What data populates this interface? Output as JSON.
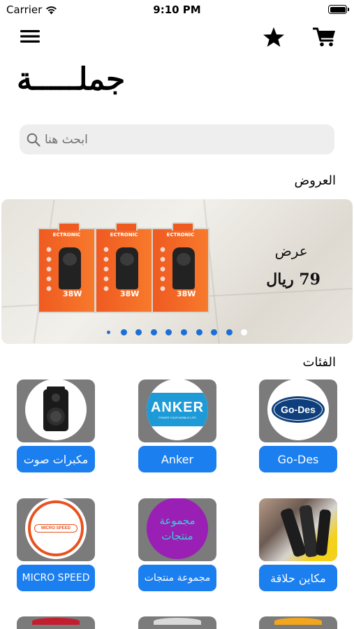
{
  "status": {
    "carrier": "Carrier",
    "time": "9:10 PM"
  },
  "header": {
    "title": "جملـــــة"
  },
  "search": {
    "placeholder": "ابحث هنا"
  },
  "offers": {
    "title": "العروض",
    "banner": {
      "product_brand": "ECTRONIC",
      "product_watt": "38W",
      "offer_line1": "عرض",
      "offer_line2": "79 ريال"
    },
    "page_count": 10,
    "active_page": 10
  },
  "categories": {
    "title": "الفئات",
    "items": [
      {
        "label": "مكبرات صوت",
        "icon": "speaker-icon"
      },
      {
        "label": "Anker",
        "logo_text": "ANKER",
        "logo_sub": "POWER YOUR MOBILE LIFE",
        "icon": "anker-logo"
      },
      {
        "label": "Go-Des",
        "logo_text": "Go-Des",
        "icon": "godes-logo"
      },
      {
        "label": "MICRO SPEED",
        "logo_text": "MICRO SPEED",
        "icon": "microspeed-logo"
      },
      {
        "label": "مجموعة منتجات",
        "logo_text_1": "مجموعة",
        "logo_text_2": "منتجات",
        "icon": "products-group-logo"
      },
      {
        "label": "مكاين حلاقة",
        "icon": "shaver-icon"
      }
    ]
  },
  "colors": {
    "accent": "#1b7fef",
    "thumb_bg": "#7b7b7b",
    "search_bg": "#eeeeef"
  }
}
